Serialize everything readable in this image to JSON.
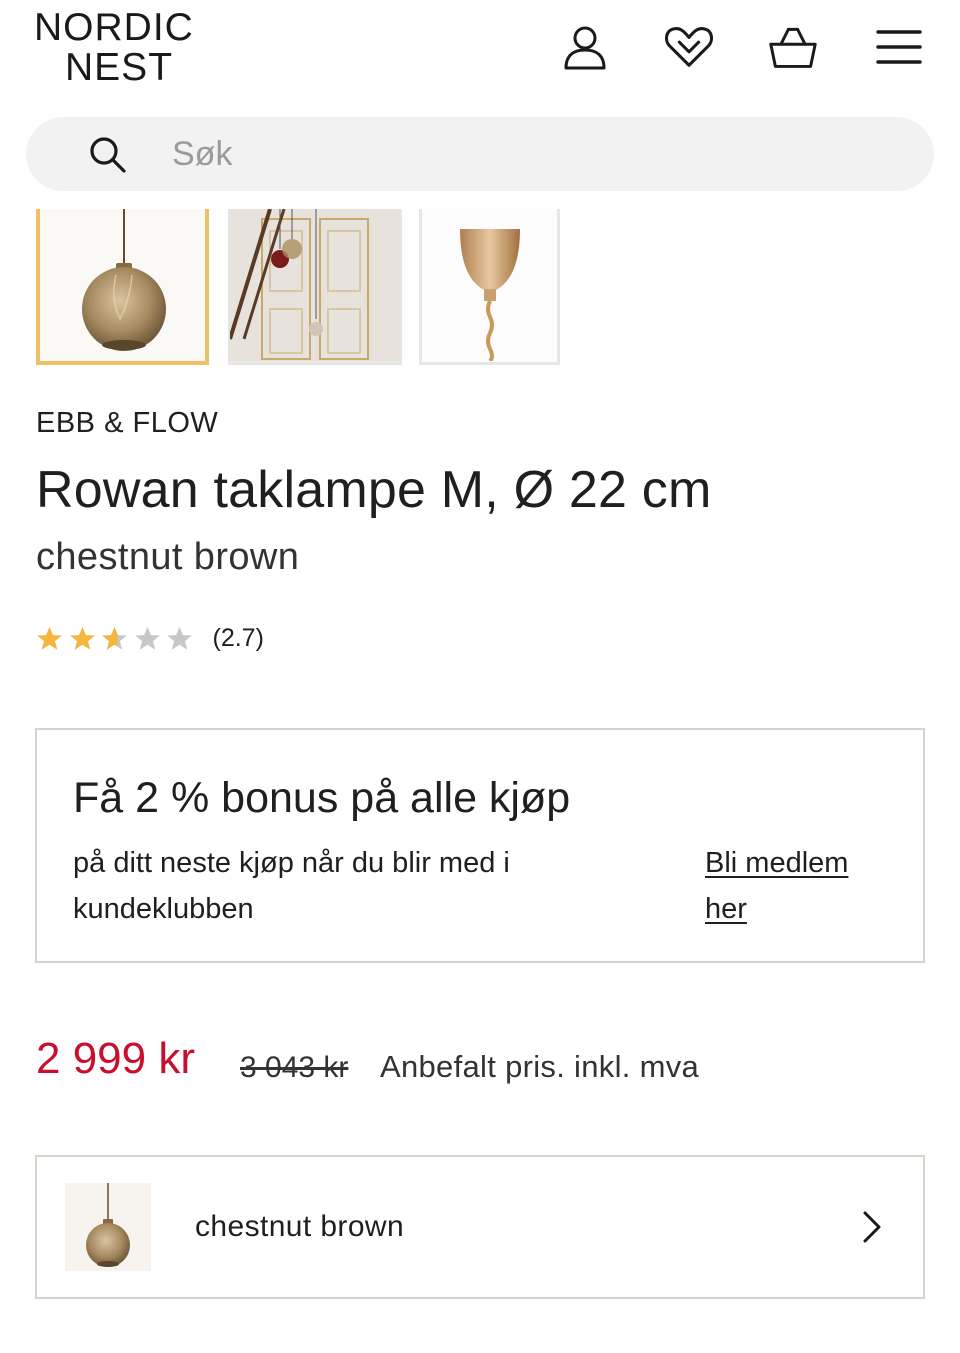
{
  "header": {
    "logo_line1": "NORDIC",
    "logo_line2": "NEST",
    "icons": [
      "user-icon",
      "heart-icon",
      "basket-icon",
      "menu-icon"
    ]
  },
  "search": {
    "placeholder": "Søk",
    "icon": "search-icon"
  },
  "gallery": {
    "selected_index": 0,
    "accent_color": "#f0c068"
  },
  "product": {
    "brand": "EBB & FLOW",
    "title": "Rowan taklampe M, Ø 22 cm",
    "variant": "chestnut brown",
    "rating": 2.7,
    "rating_text": "(2.7)",
    "rating_max": 5
  },
  "bonus": {
    "title": "Få 2 % bonus på alle kjøp",
    "text": "på ditt neste kjøp når du blir med i kundeklubben",
    "link": "Bli medlem her"
  },
  "pricing": {
    "price": "2 999 kr",
    "old_price": "3 043 kr",
    "note": "Anbefalt pris. inkl. mva",
    "price_color": "#c8102e"
  },
  "variant_selector": {
    "label": "chestnut brown",
    "icon": "chevron-right-icon"
  }
}
